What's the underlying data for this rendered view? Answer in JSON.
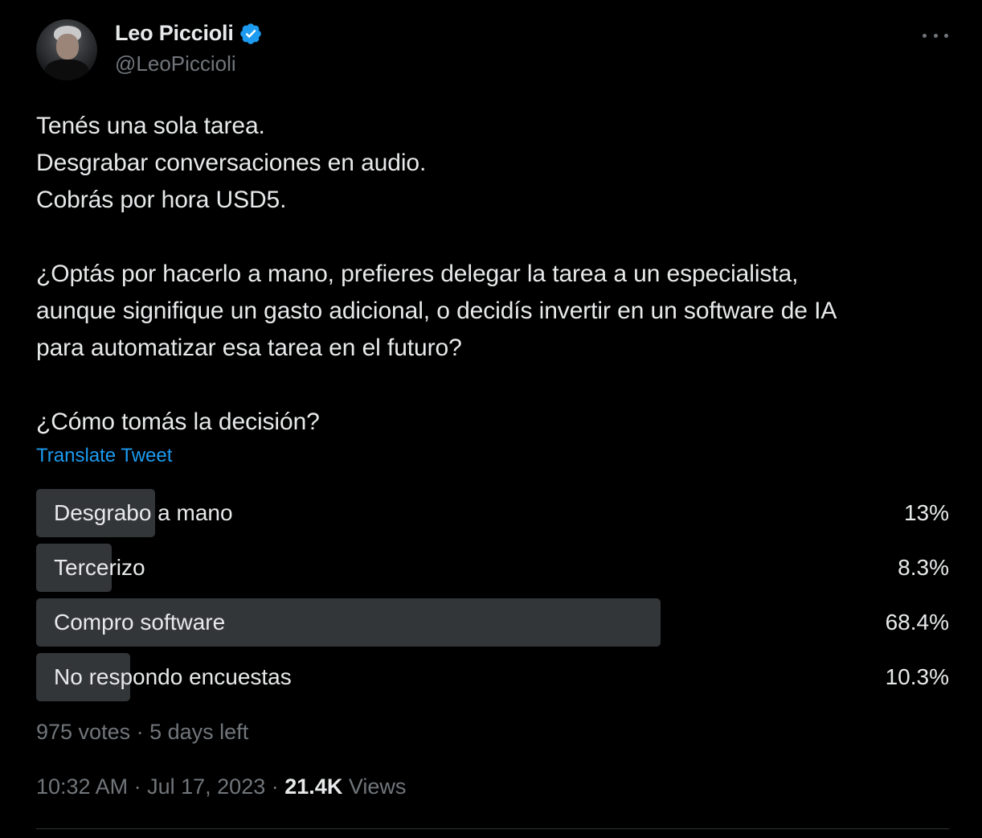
{
  "author": {
    "display_name": "Leo Piccioli",
    "handle": "@LeoPiccioli",
    "verified": true,
    "verified_color": "#1d9bf0"
  },
  "tweet": {
    "lines": [
      "Tenés una sola tarea.",
      "Desgrabar conversaciones en audio.",
      "Cobrás por hora USD5.",
      "",
      "¿Optás por hacerlo a mano, prefieres delegar la tarea a un especialista,",
      "aunque signifique un gasto adicional, o decidís invertir en un software de IA",
      "para automatizar esa tarea en el futuro?",
      "",
      "¿Cómo tomás la decisión?"
    ],
    "translate_label": "Translate Tweet"
  },
  "poll": {
    "options": [
      {
        "label": "Desgrabo a mano",
        "percent_label": "13%",
        "fraction": 0.13
      },
      {
        "label": "Tercerizo",
        "percent_label": "8.3%",
        "fraction": 0.083
      },
      {
        "label": "Compro software",
        "percent_label": "68.4%",
        "fraction": 0.684
      },
      {
        "label": "No respondo encuestas",
        "percent_label": "10.3%",
        "fraction": 0.103
      }
    ],
    "votes": "975 votes",
    "separator": "·",
    "time_left": "5 days left"
  },
  "meta": {
    "time": "10:32 AM",
    "separator": "·",
    "date": "Jul 17, 2023",
    "views_count": "21.4K",
    "views_label": "Views"
  },
  "colors": {
    "background": "#000000",
    "text": "#e7e9ea",
    "muted": "#71767b",
    "link": "#1d9bf0",
    "poll_bar": "#333639"
  }
}
